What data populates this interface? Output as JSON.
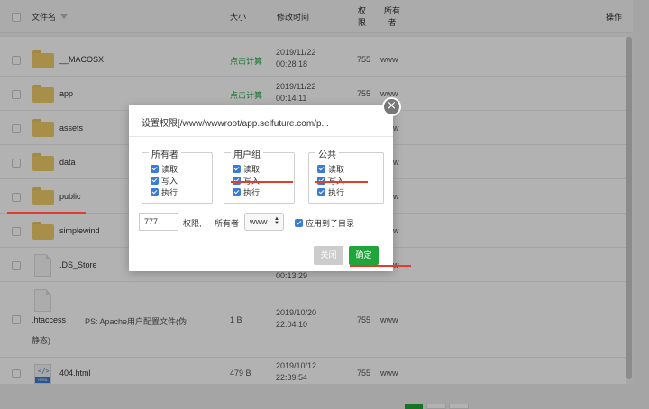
{
  "header": {
    "col_name": "文件名",
    "col_size": "大小",
    "col_mtime": "修改时间",
    "col_perm_top": "权",
    "col_perm_bottom": "限",
    "col_owner_top": "所有",
    "col_owner_bottom": "者",
    "col_action": "操作"
  },
  "rows": [
    {
      "name": "__MACOSX",
      "size": "点击计算",
      "date": "2019/11/22",
      "time": "00:28:18",
      "perm": "755",
      "owner": "www"
    },
    {
      "name": "app",
      "size": "点击计算",
      "date": "2019/11/22",
      "time": "00:14:11",
      "perm": "755",
      "owner": "www"
    },
    {
      "name": "assets",
      "perm": "",
      "owner": "w"
    },
    {
      "name": "data",
      "owner": "w"
    },
    {
      "name": "public",
      "owner": "w"
    },
    {
      "name": "simplewind",
      "owner": "w"
    },
    {
      "name": ".DS_Store",
      "time": "00:13:29",
      "owner": "w"
    },
    {
      "name": ".htaccess",
      "note": "PS: Apache用户配置文件(伪",
      "note2": "静态)",
      "size": "1 B",
      "date": "2019/10/20",
      "time": "22:04:10",
      "perm": "755",
      "owner": "www"
    },
    {
      "name": "404.html",
      "size": "479 B",
      "date": "2019/10/12",
      "time": "22:39:54",
      "perm": "755",
      "owner": "www",
      "icon_label": "HTML"
    }
  ],
  "modal": {
    "title": "设置权限[/www/wwwroot/app.selfuture.com/p...",
    "close_icon": "×",
    "groups": [
      {
        "legend": "所有者",
        "options": [
          "读取",
          "写入",
          "执行"
        ]
      },
      {
        "legend": "用户组",
        "options": [
          "读取",
          "写入",
          "执行"
        ]
      },
      {
        "legend": "公共",
        "options": [
          "读取",
          "写入",
          "执行"
        ]
      }
    ],
    "perm_value": "777",
    "perm_label": "权限,",
    "owner_label": "所有者",
    "owner_value": "www",
    "apply_label": "应用到子目录",
    "btn_close": "关闭",
    "btn_ok": "确定"
  },
  "colors": {
    "accent_green": "#20a53a",
    "checkbox_blue": "#3a7bd5",
    "annotation_red": "#e33b2e",
    "folder_yellow": "#f0cd6b"
  }
}
